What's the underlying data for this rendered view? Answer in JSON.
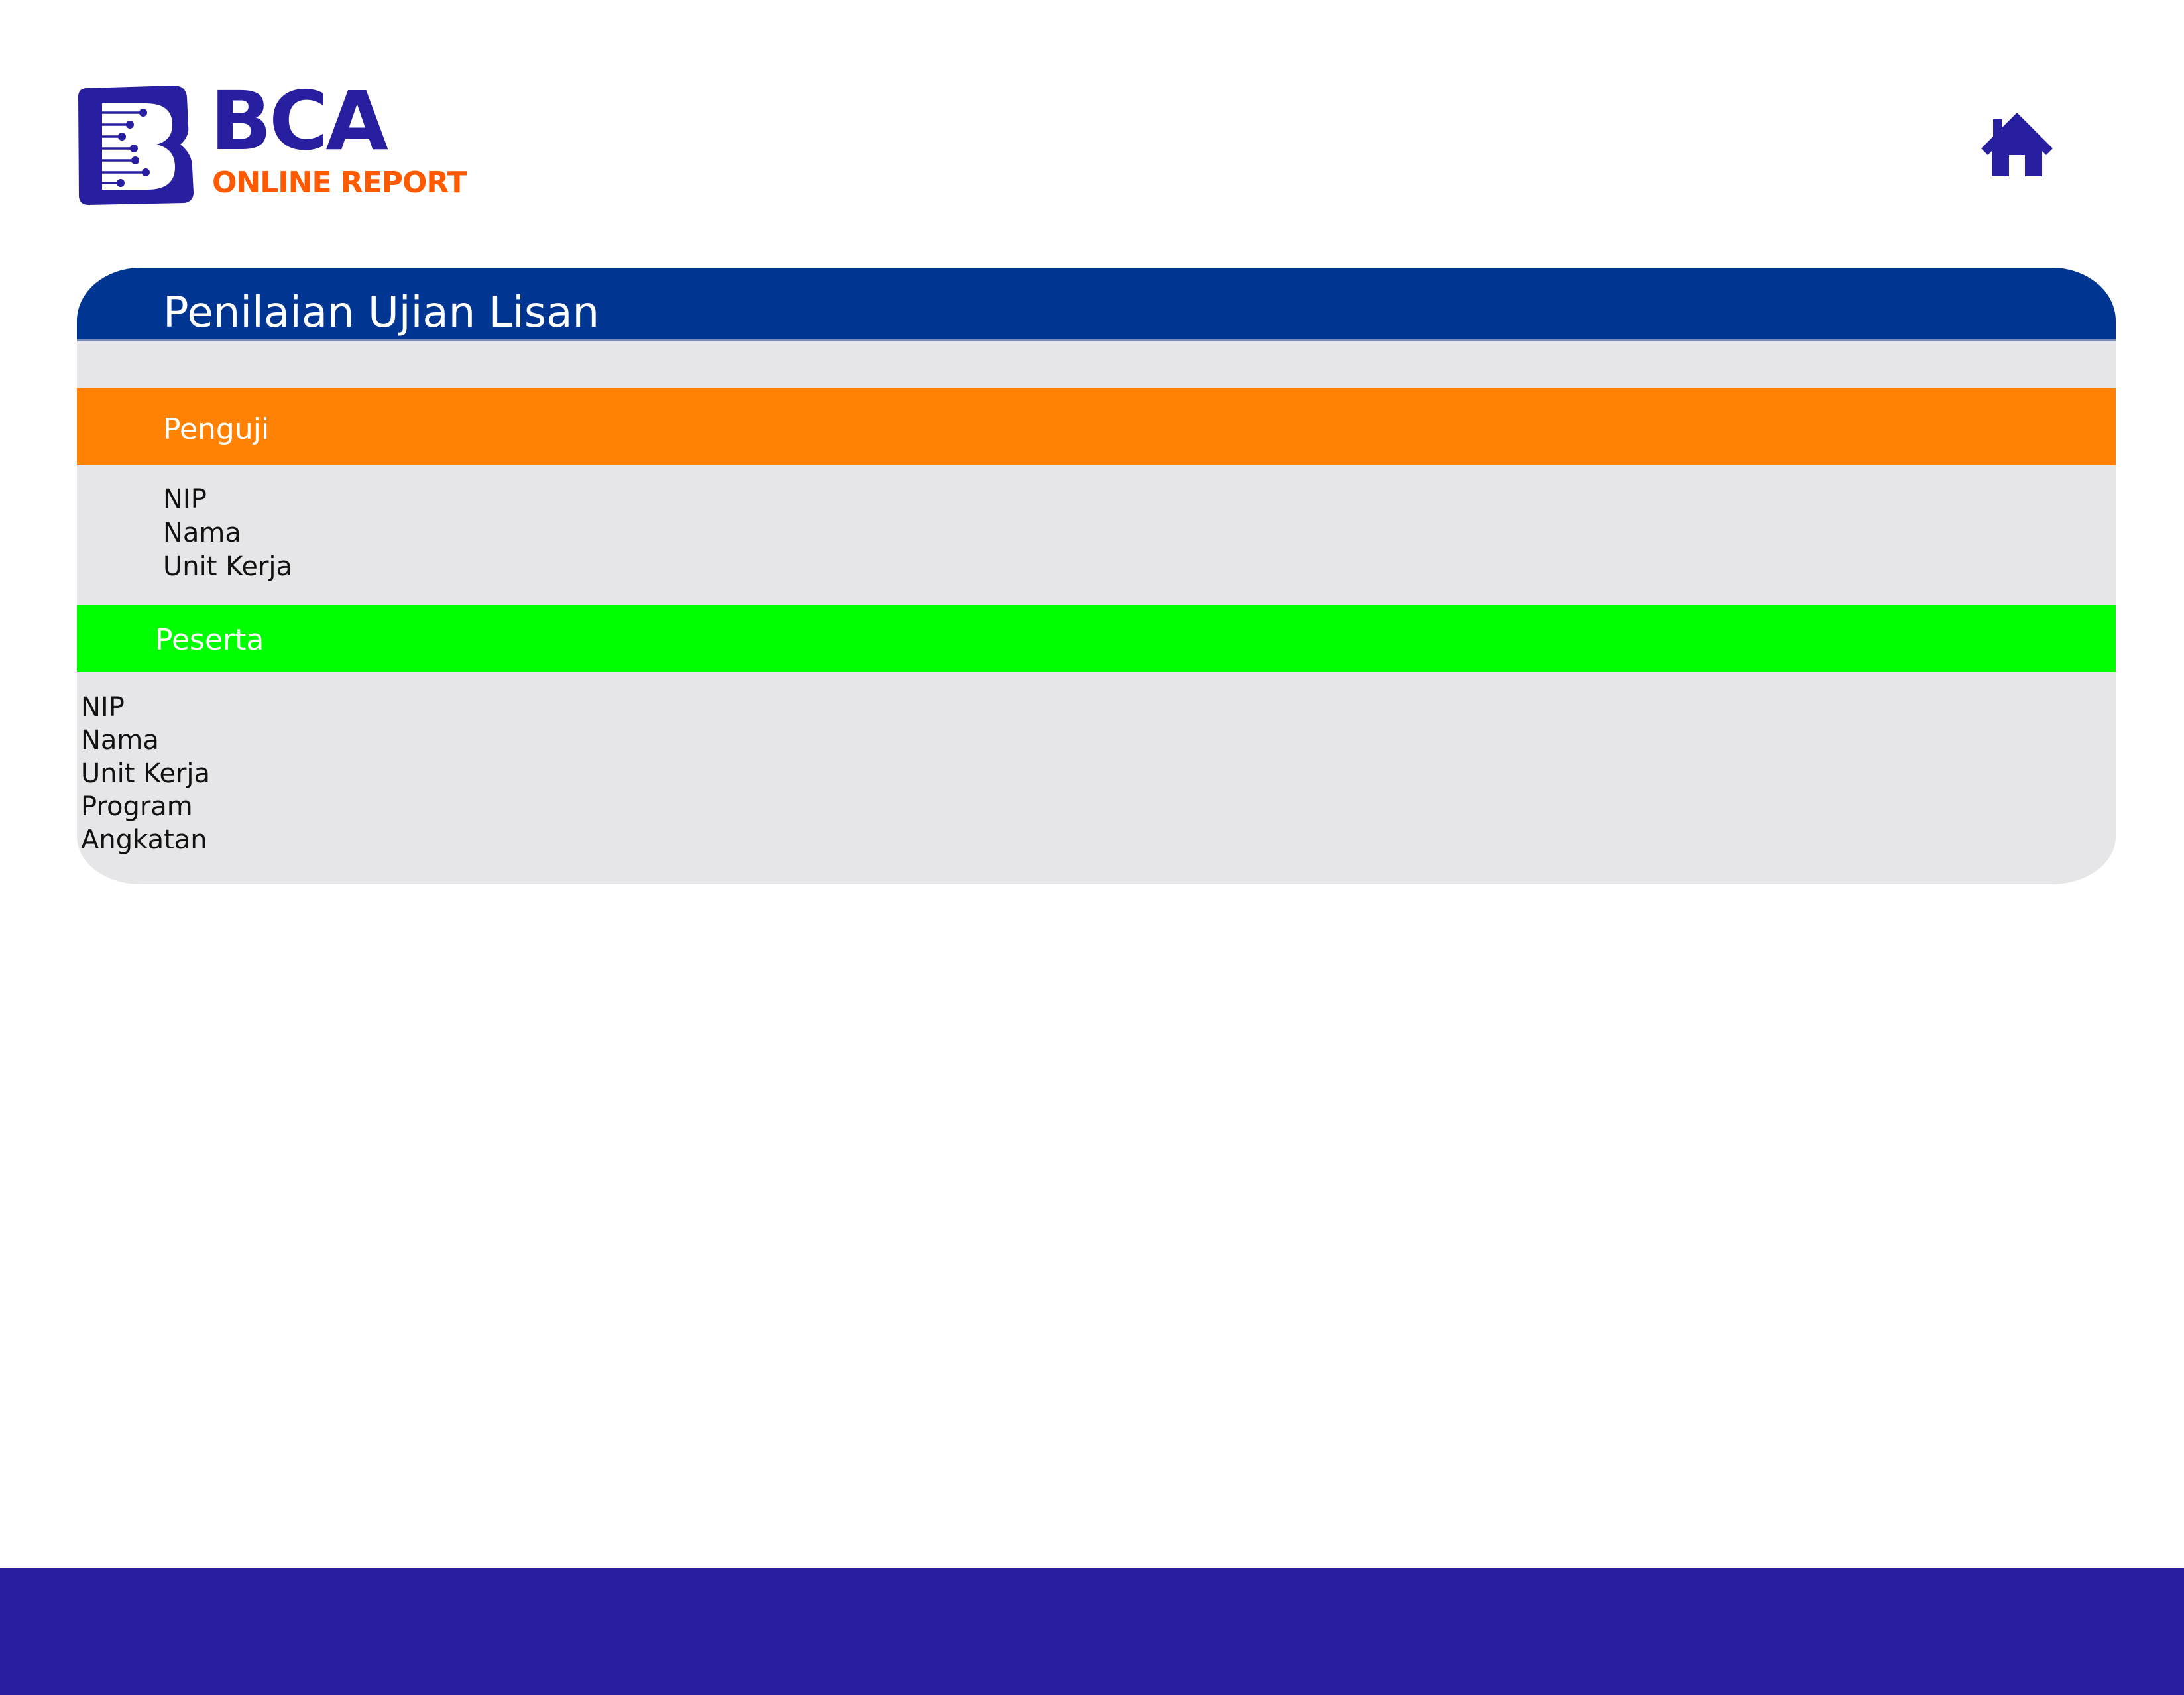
{
  "brand": {
    "name": "BCA",
    "tagline": "ONLINE REPORT",
    "colors": {
      "primary": "#281ea0",
      "accent": "#ff5a00"
    }
  },
  "header": {
    "home_icon": "home-icon"
  },
  "card": {
    "title": "Penilaian Ujian Lisan",
    "header_color": "#003591",
    "background_color": "#e6e6e8"
  },
  "sections": {
    "penguji": {
      "title": "Penguji",
      "color": "#ff8204",
      "fields": [
        "NIP",
        "Nama",
        "Unit Kerja"
      ]
    },
    "peserta": {
      "title": "Peserta",
      "color": "#00ff00",
      "fields": [
        "NIP",
        "Nama",
        "Unit Kerja",
        "Program",
        "Angkatan"
      ]
    }
  },
  "footer": {
    "color": "#281ea0"
  }
}
